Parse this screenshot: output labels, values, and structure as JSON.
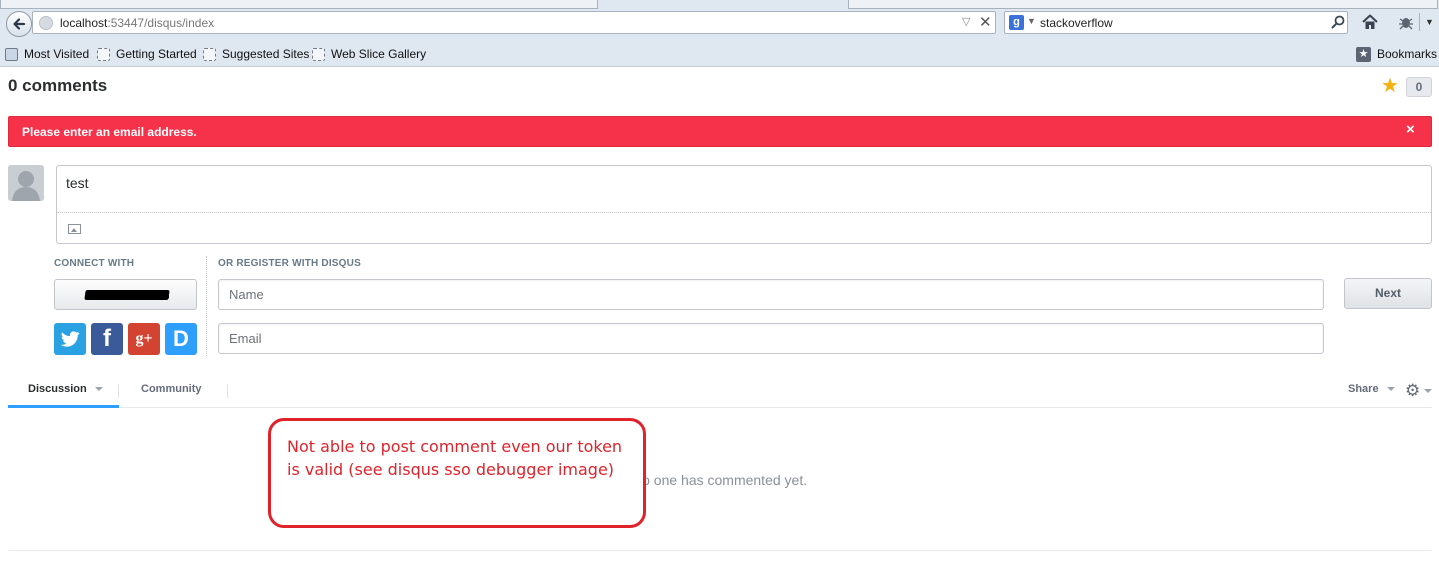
{
  "browser": {
    "url_host": "localhost",
    "url_path": ":53447/disqus/index",
    "search_query": "stackoverflow",
    "search_engine_icon": "google-icon",
    "bookmarks": [
      "Most Visited",
      "Getting Started",
      "Suggested Sites",
      "Web Slice Gallery"
    ],
    "bookmarks_menu_label": "Bookmarks"
  },
  "disqus": {
    "comment_count_title": "0 comments",
    "recommend_count": "0",
    "alert_message": "Please enter an email address.",
    "alert_close": "×",
    "alert_color": "#f6324a",
    "editor_text": "test",
    "connect_label": "CONNECT WITH",
    "register_label": "OR REGISTER WITH DISQUS",
    "name_placeholder": "Name",
    "email_placeholder": "Email",
    "next_label": "Next",
    "social": {
      "twitter_icon": "twitter-icon",
      "facebook_letter": "f",
      "googleplus_letter": "g+",
      "disqus_letter": "D"
    },
    "tabs": {
      "discussion": "Discussion",
      "community": "Community",
      "share": "Share"
    },
    "empty_message": "No one has commented yet.",
    "accent_color": "#2e9fff"
  },
  "annotation": {
    "text": "Not able to post comment even our token is valid (see disqus sso debugger image)",
    "color": "#e0232b"
  }
}
